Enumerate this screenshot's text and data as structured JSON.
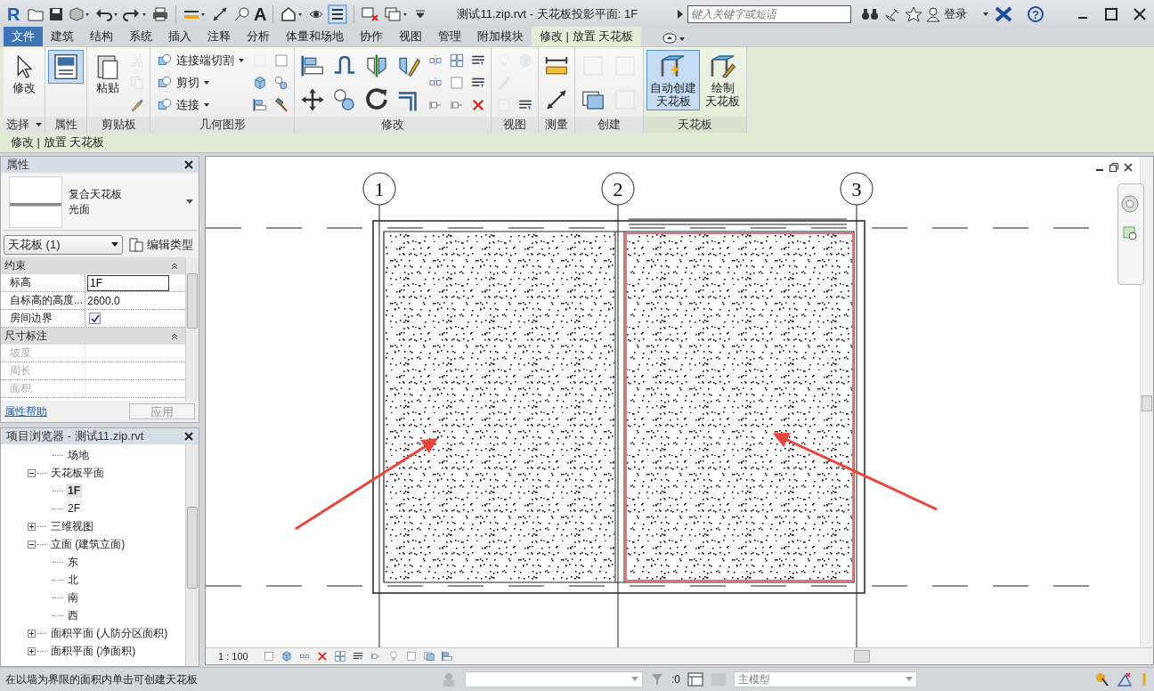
{
  "app": {
    "logo": "R",
    "text_tool": "A",
    "title": "测试11.zip.rvt - 天花板投影平面: 1F",
    "help": "?"
  },
  "search": {
    "placeholder": "键入关键字或短语"
  },
  "login": "登录",
  "tabs": [
    {
      "label": "文件",
      "kind": "app",
      "selected": false
    },
    {
      "label": "建筑",
      "kind": "tab",
      "selected": false
    },
    {
      "label": "结构",
      "kind": "tab",
      "selected": false
    },
    {
      "label": "系统",
      "kind": "tab",
      "selected": false
    },
    {
      "label": "插入",
      "kind": "tab",
      "selected": false
    },
    {
      "label": "注释",
      "kind": "tab",
      "selected": false
    },
    {
      "label": "分析",
      "kind": "tab",
      "selected": false
    },
    {
      "label": "体量和场地",
      "kind": "tab",
      "selected": false
    },
    {
      "label": "协作",
      "kind": "tab",
      "selected": false
    },
    {
      "label": "视图",
      "kind": "tab",
      "selected": false
    },
    {
      "label": "管理",
      "kind": "tab",
      "selected": false
    },
    {
      "label": "附加模块",
      "kind": "tab",
      "selected": false
    },
    {
      "label": "修改 | 放置 天花板",
      "kind": "context",
      "selected": true
    }
  ],
  "ribbon_panels": [
    {
      "title": "选择",
      "menu": true,
      "contextual": false,
      "items": [
        {
          "kind": "large",
          "lines": [
            "修改"
          ],
          "selected": false,
          "disabled": false
        }
      ]
    },
    {
      "title": "属性",
      "menu": false,
      "contextual": false,
      "items": [
        {
          "kind": "large",
          "selected": true,
          "disabled": false
        }
      ]
    },
    {
      "title": "剪贴板",
      "menu": false,
      "contextual": false,
      "items": [
        {
          "kind": "large",
          "lines": [
            "粘贴"
          ],
          "selected": false,
          "disabled": false
        },
        {
          "kind": "icon",
          "selected": false,
          "disabled": true
        },
        {
          "kind": "icon",
          "selected": false,
          "disabled": true
        },
        {
          "kind": "icon",
          "selected": false,
          "disabled": false
        }
      ]
    },
    {
      "title": "几何图形",
      "menu": false,
      "contextual": false,
      "items": [
        {
          "kind": "small",
          "label": "连接端切割",
          "selected": false,
          "disabled": false
        },
        {
          "kind": "small",
          "label": "剪切",
          "selected": false,
          "disabled": false
        },
        {
          "kind": "small",
          "label": "连接",
          "selected": false,
          "disabled": false
        },
        {
          "kind": "icon",
          "selected": false,
          "disabled": true
        },
        {
          "kind": "icon",
          "selected": false,
          "disabled": false
        },
        {
          "kind": "icon",
          "selected": false,
          "disabled": false
        },
        {
          "kind": "icon",
          "selected": false,
          "disabled": false
        },
        {
          "kind": "icon",
          "selected": false,
          "disabled": false
        },
        {
          "kind": "icon",
          "selected": false,
          "disabled": false
        }
      ]
    },
    {
      "title": "修改",
      "menu": false,
      "contextual": false,
      "items": [
        {
          "kind": "medium",
          "selected": false,
          "disabled": false
        },
        {
          "kind": "medium",
          "selected": false,
          "disabled": false
        },
        {
          "kind": "medium",
          "selected": false,
          "disabled": false
        },
        {
          "kind": "medium",
          "selected": false,
          "disabled": false
        },
        {
          "kind": "medium",
          "selected": false,
          "disabled": false
        },
        {
          "kind": "medium",
          "selected": false,
          "disabled": false
        },
        {
          "kind": "medium",
          "selected": false,
          "disabled": false
        },
        {
          "kind": "medium",
          "selected": false,
          "disabled": false
        },
        {
          "kind": "icon",
          "selected": false,
          "disabled": false
        },
        {
          "kind": "icon",
          "selected": false,
          "disabled": false
        },
        {
          "kind": "icon",
          "selected": false,
          "disabled": false
        },
        {
          "kind": "icon",
          "selected": false,
          "disabled": false
        },
        {
          "kind": "icon",
          "selected": false,
          "disabled": false
        },
        {
          "kind": "icon",
          "selected": false,
          "disabled": false
        },
        {
          "kind": "icon",
          "selected": false,
          "disabled": false
        },
        {
          "kind": "icon",
          "selected": false,
          "disabled": false
        },
        {
          "kind": "icon",
          "selected": false,
          "disabled": false
        }
      ]
    },
    {
      "title": "视图",
      "menu": false,
      "contextual": false,
      "items": [
        {
          "kind": "icon",
          "selected": false,
          "disabled": true
        },
        {
          "kind": "icon",
          "selected": false,
          "disabled": true
        },
        {
          "kind": "icon",
          "selected": false,
          "disabled": true
        },
        {
          "kind": "icon",
          "selected": false,
          "disabled": true
        },
        {
          "kind": "icon",
          "selected": false,
          "disabled": false
        }
      ]
    },
    {
      "title": "测量",
      "menu": false,
      "contextual": false,
      "items": [
        {
          "kind": "medium",
          "selected": false,
          "disabled": false
        },
        {
          "kind": "medium",
          "selected": false,
          "disabled": false
        }
      ]
    },
    {
      "title": "创建",
      "menu": false,
      "contextual": false,
      "items": [
        {
          "kind": "medium",
          "selected": false,
          "disabled": true
        },
        {
          "kind": "medium",
          "selected": false,
          "disabled": false
        },
        {
          "kind": "medium",
          "selected": false,
          "disabled": true
        },
        {
          "kind": "medium",
          "selected": false,
          "disabled": true
        }
      ]
    },
    {
      "title": "天花板",
      "menu": false,
      "contextual": true,
      "items": [
        {
          "kind": "large",
          "lines": [
            "自动创建",
            "天花板"
          ],
          "selected": true,
          "disabled": false
        },
        {
          "kind": "large",
          "lines": [
            "绘制",
            "天花板"
          ],
          "selected": false,
          "disabled": false
        }
      ]
    }
  ],
  "context_label": "修改 | 放置 天花板",
  "properties": {
    "title": "属性",
    "type_name": "复合天花板",
    "type_sub": "光面",
    "selector": "天花板 (1)",
    "edit_type": "编辑类型",
    "groups": [
      {
        "name": "约束",
        "expanded": true,
        "rows": [
          {
            "kind": "text",
            "label": "标高",
            "value": "1F",
            "disabled": false
          },
          {
            "kind": "value",
            "label": "自标高的高度...",
            "value": "2600.0",
            "disabled": false
          },
          {
            "kind": "checkbox",
            "label": "房间边界",
            "checked": true,
            "disabled": false
          }
        ]
      },
      {
        "name": "尺寸标注",
        "expanded": true,
        "rows": [
          {
            "kind": "value",
            "label": "坡度",
            "disabled": true
          },
          {
            "kind": "value",
            "label": "周长",
            "disabled": true
          },
          {
            "kind": "value",
            "label": "面积",
            "disabled": true
          }
        ]
      }
    ],
    "help": "属性帮助",
    "apply": "应用"
  },
  "browser": {
    "title": "项目浏览器 - 测试11.zip.rvt",
    "items": [
      {
        "kind": "leaf",
        "label": "场地",
        "selected": false
      },
      {
        "kind": "folder",
        "label": "天花板平面",
        "expanded": true,
        "selected": false,
        "children": [
          {
            "label": "1F",
            "selected": true
          },
          {
            "label": "2F",
            "selected": false
          }
        ]
      },
      {
        "kind": "folder",
        "label": "三维视图",
        "expanded": false,
        "selected": false
      },
      {
        "kind": "folder",
        "label": "立面 (建筑立面)",
        "expanded": true,
        "selected": false,
        "children": [
          {
            "label": "东",
            "selected": false
          },
          {
            "label": "北",
            "selected": false
          },
          {
            "label": "南",
            "selected": false
          },
          {
            "label": "西",
            "selected": false
          }
        ]
      },
      {
        "kind": "folder",
        "label": "面积平面 (人防分区面积)",
        "expanded": false,
        "selected": false
      },
      {
        "kind": "folder",
        "label": "面积平面 (净面积)",
        "expanded": false,
        "selected": false
      }
    ]
  },
  "view": {
    "grid_bubbles": [
      "1",
      "2",
      "3"
    ],
    "ceilings": [
      {
        "highlighted": false
      },
      {
        "highlighted": true
      }
    ],
    "scale": "1 : 100"
  },
  "status_bar": {
    "message": "在以墙为界限的面积内单击可创建天花板",
    "count": ":0",
    "model": "主模型"
  }
}
